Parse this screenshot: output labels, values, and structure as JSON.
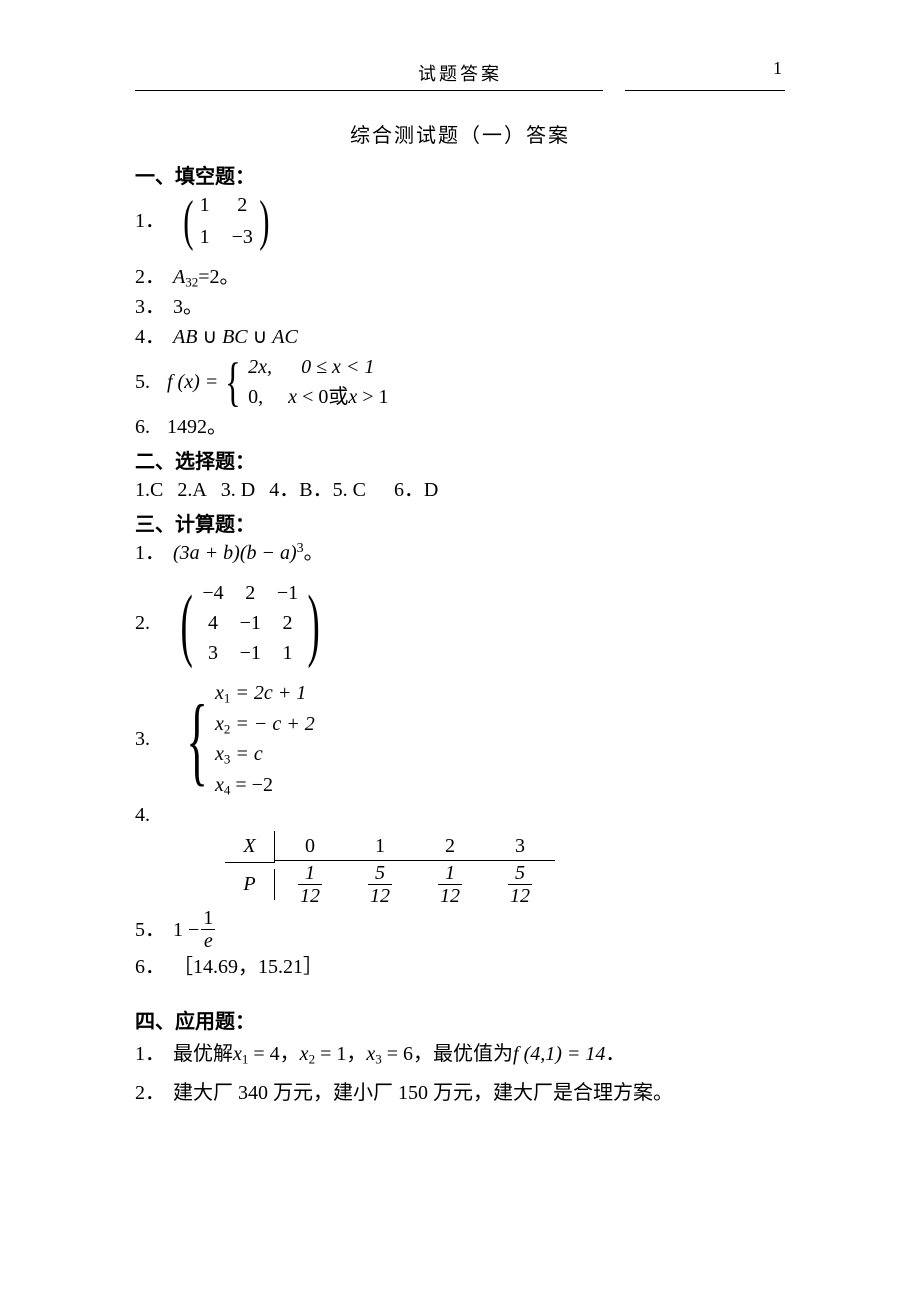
{
  "header": {
    "label": "试题答案",
    "page_number": "1"
  },
  "title": "综合测试题（一）答案",
  "sections": {
    "fill": "一、填空题：",
    "choice": "二、选择题：",
    "calc": "三、计算题：",
    "app": "四、应用题："
  },
  "fill": {
    "q1": {
      "num": "1．",
      "m": [
        [
          "1",
          "2"
        ],
        [
          "1",
          "−3"
        ]
      ]
    },
    "q2": {
      "num": "2．",
      "lhs_var": "A",
      "lhs_sub": "32",
      "eq": " = ",
      "rhs": "2",
      "tail": "  。"
    },
    "q3": {
      "num": "3．",
      "val": "3",
      "tail": "。"
    },
    "q4": {
      "num": "4．",
      "expr_parts": [
        "AB",
        " ∪ ",
        "BC",
        " ∪ ",
        "AC"
      ]
    },
    "q5": {
      "num": "5.",
      "lhs": "f (x) =",
      "rows": [
        {
          "left": "2x,",
          "cond": "0 ≤ x < 1"
        },
        {
          "left": " 0,",
          "cond": "x < 0 或 x > 1"
        }
      ]
    },
    "q6": {
      "num": "6.",
      "val": "1492",
      "tail": "。"
    }
  },
  "choice": {
    "items": [
      "1.C",
      "2.A",
      "3. D",
      "4．B．",
      "5. C",
      "6．D"
    ]
  },
  "calc": {
    "q1": {
      "num": "1．",
      "expr": "(3a + b)(b − a)",
      "sup": "3",
      "tail": "。"
    },
    "q2": {
      "num": "2.",
      "m": [
        [
          "−4",
          "2",
          "−1"
        ],
        [
          "4",
          "−1",
          "2"
        ],
        [
          "3",
          "−1",
          "1"
        ]
      ]
    },
    "q3": {
      "num": "3.",
      "rows": [
        {
          "v": "x",
          "s": "1",
          "r": " = 2c + 1"
        },
        {
          "v": "x",
          "s": "2",
          "r": " = − c + 2"
        },
        {
          "v": "x",
          "s": "3",
          "r": " = c"
        },
        {
          "v": "x",
          "s": "4",
          "r": " = −2"
        }
      ]
    },
    "q4": {
      "num": "4.",
      "head_var": "X",
      "row_var": "P",
      "xs": [
        "0",
        "1",
        "2",
        "3"
      ],
      "ps": [
        {
          "n": "1",
          "d": "12"
        },
        {
          "n": "5",
          "d": "12"
        },
        {
          "n": "1",
          "d": "12"
        },
        {
          "n": "5",
          "d": "12"
        }
      ]
    },
    "q5": {
      "num": "5．",
      "lead": "1 −",
      "frac": {
        "n": "1",
        "d": "e"
      }
    },
    "q6": {
      "num": "6．",
      "val": "［14.69，15.21］"
    }
  },
  "app": {
    "q1": {
      "num": "1．",
      "t1": "最优解",
      "v1": {
        "v": "x",
        "s": "1",
        "r": " = 4"
      },
      "c1": "，",
      "v2": {
        "v": "x",
        "s": "2",
        "r": " = 1"
      },
      "c2": "，",
      "v3": {
        "v": "x",
        "s": "3",
        "r": " = 6"
      },
      "c3": "，",
      "t2": "最优值为",
      "f": "f (4,1) = 14",
      "tail": "．"
    },
    "q2": {
      "num": "2．",
      "text": "建大厂 340 万元，建小厂 150 万元，建大厂是合理方案。"
    }
  }
}
